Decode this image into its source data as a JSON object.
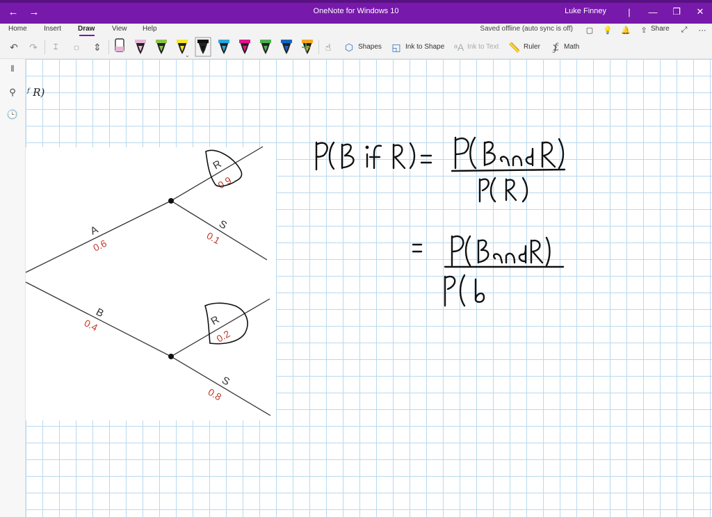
{
  "window": {
    "title": "OneNote for Windows 10",
    "user": "Luke Finney"
  },
  "menu": {
    "tabs": [
      "Home",
      "Insert",
      "Draw",
      "View",
      "Help"
    ],
    "active_tab": "Draw",
    "status": "Saved offline (auto sync is off)",
    "share_label": "Share"
  },
  "toolbar": {
    "shapes_label": "Shapes",
    "ink_to_shape_label": "Ink to Shape",
    "ink_to_text_label": "Ink to Text",
    "ruler_label": "Ruler",
    "math_label": "Math",
    "pens": [
      {
        "name": "pencil",
        "color": "#e8b4d8"
      },
      {
        "name": "pen",
        "color": "#8bc34a"
      },
      {
        "name": "highlighter",
        "color": "#f6e627"
      },
      {
        "name": "pen",
        "color": "#111111"
      },
      {
        "name": "pen",
        "color": "#29a8e0"
      },
      {
        "name": "pen",
        "color": "#e0148b"
      },
      {
        "name": "pen",
        "color": "#4caf50"
      },
      {
        "name": "pen",
        "color": "#1565c0"
      },
      {
        "name": "pen",
        "color": "#f4a81d"
      }
    ]
  },
  "page": {
    "fragment": "ᶠ R)"
  },
  "tree": {
    "branch_A": {
      "label": "A",
      "prob": "0.6"
    },
    "branch_B": {
      "label": "B",
      "prob": "0.4"
    },
    "branch_AR": {
      "label": "R",
      "prob": "0.9"
    },
    "branch_AS": {
      "label": "S",
      "prob": "0.1"
    },
    "branch_BR": {
      "label": "R",
      "prob": "0.2"
    },
    "branch_BS": {
      "label": "S",
      "prob": "0.8"
    }
  },
  "colors": {
    "accent": "#7719aa",
    "grid": "#b9d9ee",
    "prob_text": "#c0392b"
  }
}
